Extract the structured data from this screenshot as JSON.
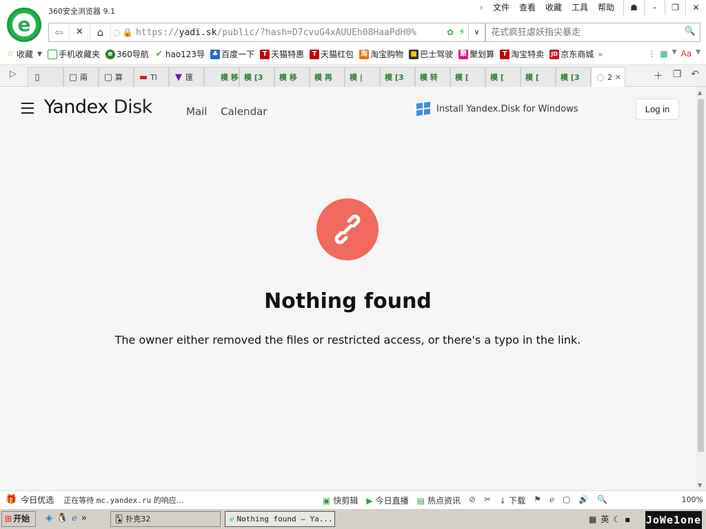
{
  "browser": {
    "title": "360安全浏览器 9.1",
    "menu": [
      "文件",
      "查看",
      "收藏",
      "工具",
      "帮助"
    ],
    "url": {
      "scheme": "https://",
      "host": "yadi.sk",
      "path": "/public/?hash=D7cvuG4xAUUEh08HaaPdH0%"
    },
    "search_placeholder": "花式疯狂虐妖指尖暴走",
    "bookmarks": [
      "收藏",
      "手机收藏夹",
      "360导航",
      "hao123导",
      "百度一下",
      "天猫特惠",
      "天猫红包",
      "淘宝购物",
      "巴士驾驶",
      "聚划算",
      "淘宝特卖",
      "京东商城"
    ],
    "tabs": [
      "兩",
      "算",
      "Tl",
      "匯",
      "模 移",
      "模 [3",
      "模 移",
      "模 再",
      "模 |",
      "模 [3",
      "模 转",
      "模 [",
      "模 [",
      "模 [",
      "模 [3",
      "2"
    ],
    "status": {
      "daily": "今日优选",
      "loading": "正在等待",
      "loading_host": "mc.yandex.ru",
      "loading_suffix": "的响应…",
      "items": [
        "快剪辑",
        "今日直播",
        "热点资讯",
        "下载"
      ],
      "zoom": "100%"
    }
  },
  "page": {
    "brand": {
      "yandex": "Yandex",
      "disk": "Disk"
    },
    "nav": {
      "mail": "Mail",
      "calendar": "Calendar"
    },
    "install": "Install Yandex.Disk for Windows",
    "login": "Log in",
    "title": "Nothing found",
    "description": "The owner either removed the files or restricted access, or there's a typo in the link.",
    "accent_color": "#f26a5d"
  },
  "taskbar": {
    "start": "开始",
    "tasks": [
      "扑克32",
      "Nothing found — Ya..."
    ],
    "ime": "英",
    "clock": "JoWe1one"
  }
}
